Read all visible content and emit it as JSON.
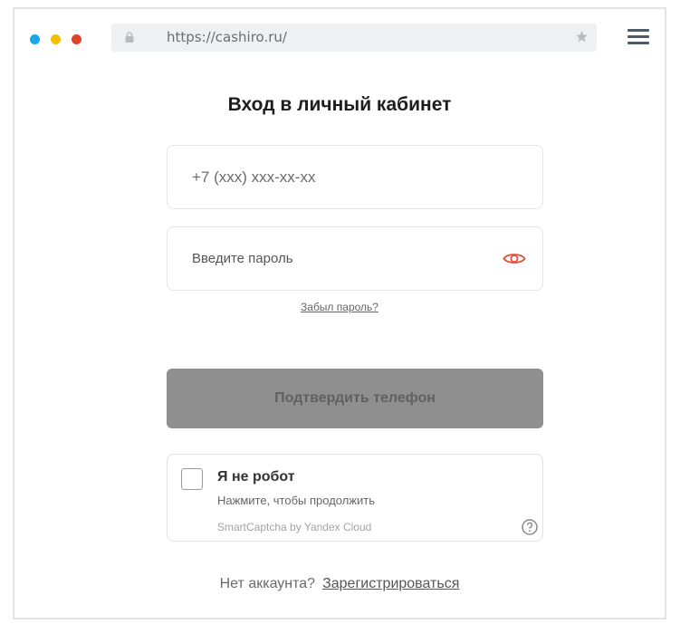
{
  "browser": {
    "url": "https://cashiro.ru/",
    "dots": [
      "#1aa5e6",
      "#f4bf00",
      "#e0442a"
    ]
  },
  "page": {
    "title": "Вход в личный кабинет",
    "phone_placeholder": "+7 (xxx) xxx-xx-xx",
    "password_placeholder": "Введите пароль",
    "forgot_password": "Забыл пароль?",
    "confirm_button": "Подтвердить телефон",
    "no_account": "Нет аккаунта?",
    "register_link": "Зарегистрироваться"
  },
  "captcha": {
    "title": "Я не робот",
    "subtitle": "Нажмите, чтобы продолжить",
    "brand": "SmartCaptcha by Yandex Cloud"
  },
  "icons": {
    "lock": "lock-icon",
    "star": "star-icon",
    "menu": "hamburger-menu-icon",
    "eye": "eye-icon",
    "help": "question-icon"
  },
  "colors": {
    "accent_eye": "#e4503b",
    "button_disabled": "#8f8f90"
  }
}
